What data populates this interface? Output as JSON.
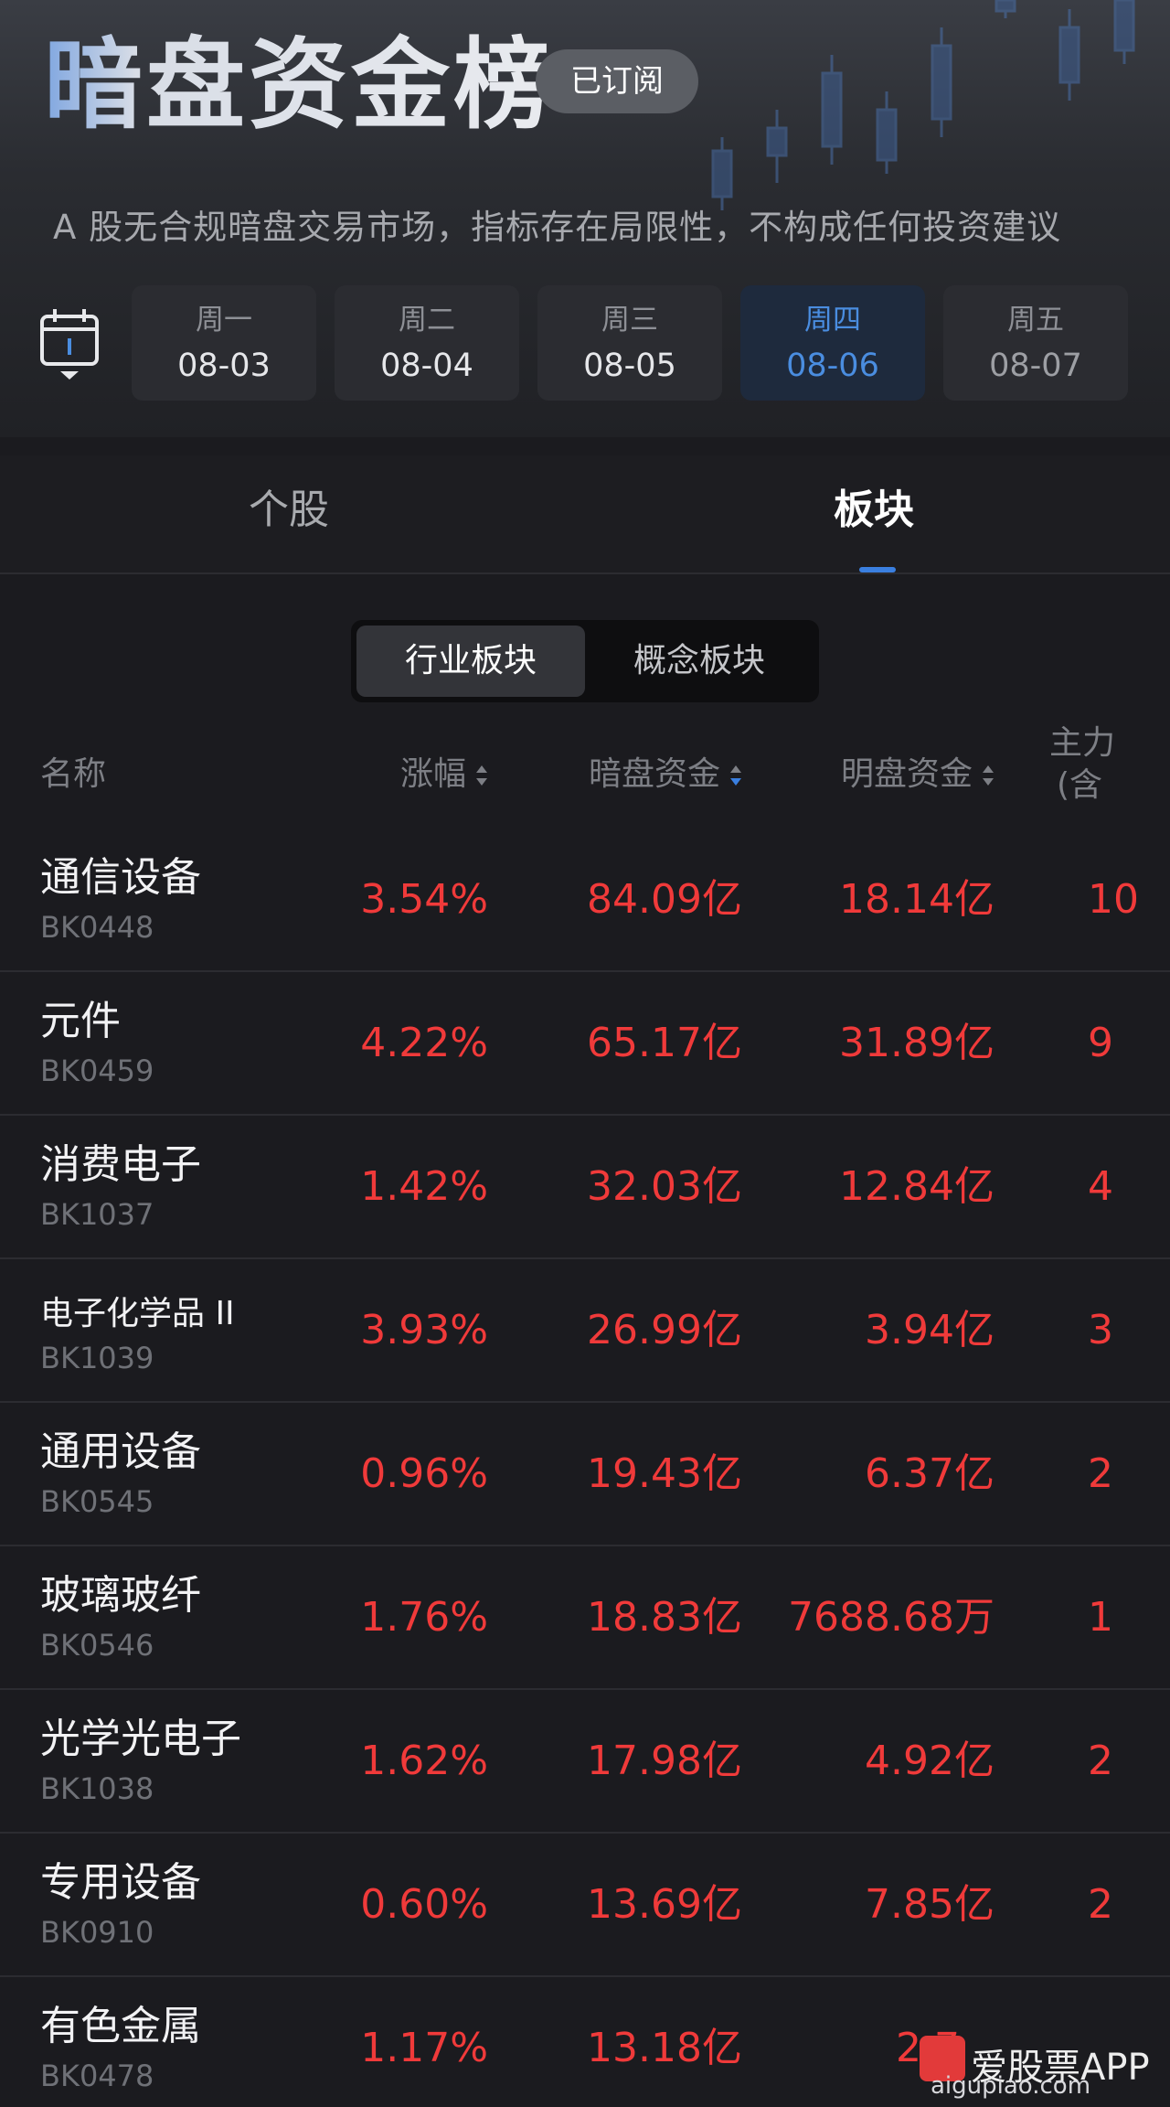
{
  "header": {
    "title": "暗盘资金榜",
    "subscribe_label": "已订阅",
    "disclaimer": "A 股无合规暗盘交易市场，指标存在局限性，不构成任何投资建议"
  },
  "days": [
    {
      "weekday": "周一",
      "date": "08-03"
    },
    {
      "weekday": "周二",
      "date": "08-04"
    },
    {
      "weekday": "周三",
      "date": "08-05"
    },
    {
      "weekday": "周四",
      "date": "08-06"
    },
    {
      "weekday": "周五",
      "date": "08-07"
    }
  ],
  "active_day": "周四",
  "tabs": {
    "stock": "个股",
    "sector": "板块"
  },
  "segments": {
    "industry": "行业板块",
    "concept": "概念板块"
  },
  "columns": {
    "name": "名称",
    "change": "涨幅",
    "dark": "暗盘资金",
    "lit": "明盘资金",
    "main_line1": "主力",
    "main_line2": "(含"
  },
  "rows": [
    {
      "name": "通信设备",
      "code": "BK0448",
      "change": "3.54%",
      "dark": "84.09亿",
      "lit": "18.14亿",
      "main": "10"
    },
    {
      "name": "元件",
      "code": "BK0459",
      "change": "4.22%",
      "dark": "65.17亿",
      "lit": "31.89亿",
      "main": "9"
    },
    {
      "name": "消费电子",
      "code": "BK1037",
      "change": "1.42%",
      "dark": "32.03亿",
      "lit": "12.84亿",
      "main": "4"
    },
    {
      "name": "电子化学品 II",
      "code": "BK1039",
      "change": "3.93%",
      "dark": "26.99亿",
      "lit": "3.94亿",
      "main": "3"
    },
    {
      "name": "通用设备",
      "code": "BK0545",
      "change": "0.96%",
      "dark": "19.43亿",
      "lit": "6.37亿",
      "main": "2"
    },
    {
      "name": "玻璃玻纤",
      "code": "BK0546",
      "change": "1.76%",
      "dark": "18.83亿",
      "lit": "7688.68万",
      "main": "1"
    },
    {
      "name": "光学光电子",
      "code": "BK1038",
      "change": "1.62%",
      "dark": "17.98亿",
      "lit": "4.92亿",
      "main": "2"
    },
    {
      "name": "专用设备",
      "code": "BK0910",
      "change": "0.60%",
      "dark": "13.69亿",
      "lit": "7.85亿",
      "main": "2"
    },
    {
      "name": "有色金属",
      "code": "BK0478",
      "change": "1.17%",
      "dark": "13.18亿",
      "lit": "2.7",
      "main": ""
    }
  ],
  "watermark": {
    "text": "爱股票APP",
    "url": "aigupiao.com"
  },
  "colors": {
    "up_red": "#f03a3a",
    "accent_blue": "#3a7fe0",
    "background": "#1b1b1f"
  }
}
